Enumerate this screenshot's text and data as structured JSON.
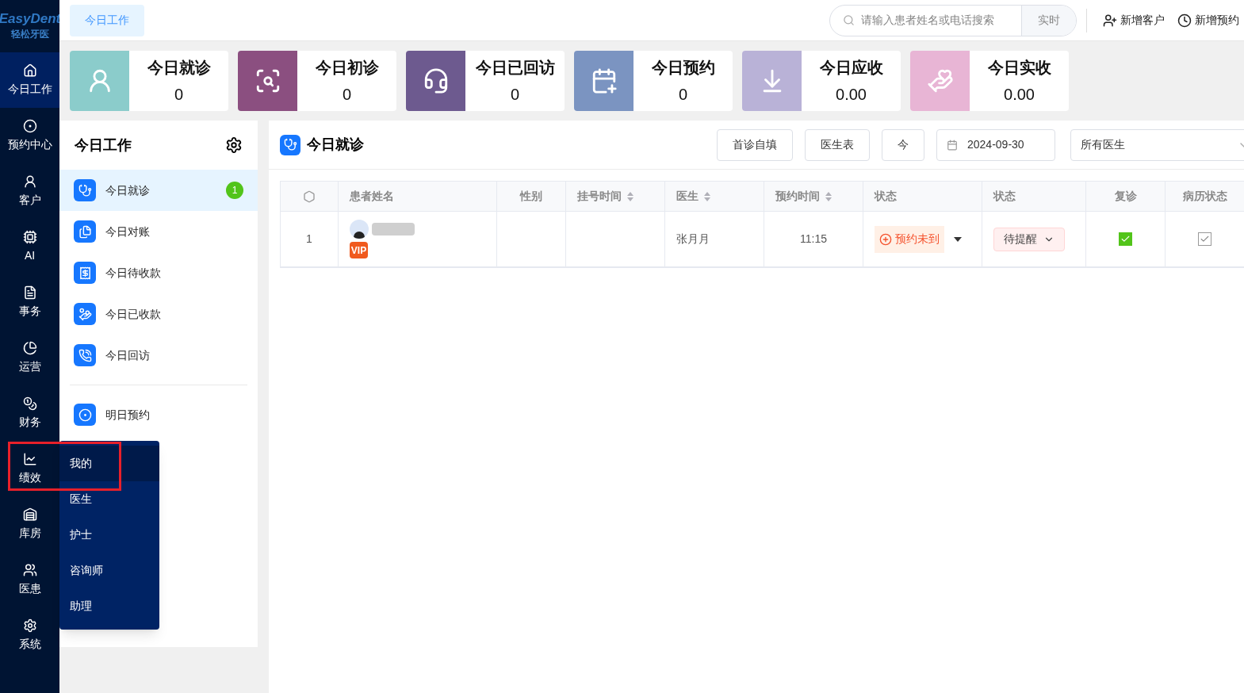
{
  "logo": {
    "title": "EasyDent",
    "subtitle": "轻松牙医"
  },
  "top_tabs": [
    {
      "label": "今日工作",
      "selected": true
    }
  ],
  "search": {
    "placeholder": "请输入患者姓名或电话搜索",
    "mode": "实时"
  },
  "top_actions": [
    {
      "kind": "customer",
      "label": "新增客户"
    },
    {
      "kind": "appointment",
      "label": "新增预约"
    }
  ],
  "nav": [
    {
      "kind": "home",
      "label": "今日工作",
      "selected": true
    },
    {
      "kind": "book",
      "label": "预约中心",
      "selected": false
    },
    {
      "kind": "user",
      "label": "客户",
      "selected": false
    },
    {
      "kind": "ai",
      "label": "AI",
      "selected": false
    },
    {
      "kind": "task",
      "label": "事务",
      "selected": false
    },
    {
      "kind": "pie",
      "label": "运营",
      "selected": false
    },
    {
      "kind": "money",
      "label": "财务",
      "selected": false
    },
    {
      "kind": "chart",
      "label": "绩效",
      "selected": false
    },
    {
      "kind": "store",
      "label": "库房",
      "selected": false
    },
    {
      "kind": "people",
      "label": "医患",
      "selected": false
    },
    {
      "kind": "gear",
      "label": "系统",
      "selected": false
    }
  ],
  "stats": [
    {
      "kind": "doctor",
      "label": "今日就诊",
      "value": "0",
      "color": "#8bcccb"
    },
    {
      "kind": "first",
      "label": "今日初诊",
      "value": "0",
      "color": "#8b4f80"
    },
    {
      "kind": "headset",
      "label": "今日已回访",
      "value": "0",
      "color": "#6d5a8f"
    },
    {
      "kind": "calendar",
      "label": "今日预约",
      "value": "0",
      "color": "#7b94c1"
    },
    {
      "kind": "receivable",
      "label": "今日应收",
      "value": "0.00",
      "color": "#b9b2d7"
    },
    {
      "kind": "received",
      "label": "今日实收",
      "value": "0.00",
      "color": "#e8b5d5"
    }
  ],
  "panel": {
    "title": "今日工作",
    "items": [
      {
        "kind": "stethoscope",
        "label": "今日就诊",
        "selected": true,
        "badge": "1"
      },
      {
        "kind": "doc",
        "label": "今日对账",
        "selected": false
      },
      {
        "kind": "pending",
        "label": "今日待收款",
        "selected": false
      },
      {
        "kind": "paid",
        "label": "今日已收款",
        "selected": false
      },
      {
        "kind": "phone",
        "label": "今日回访",
        "selected": false
      }
    ],
    "items_after_divider": [
      {
        "kind": "book",
        "label": "明日预约",
        "selected": false
      }
    ]
  },
  "popup_menu": {
    "items": [
      {
        "label": "我的",
        "selected": true
      },
      {
        "label": "医生",
        "selected": false
      },
      {
        "label": "护士",
        "selected": false
      },
      {
        "label": "咨询师",
        "selected": false
      },
      {
        "label": "助理",
        "selected": false
      }
    ]
  },
  "main": {
    "title": "今日就诊",
    "buttons": [
      "首诊自填",
      "医生表",
      "今"
    ],
    "date": "2024-09-30",
    "doctor_select": "所有医生",
    "table": {
      "columns": [
        {
          "label": "患者姓名",
          "sortable": false
        },
        {
          "label": "性别",
          "sortable": false
        },
        {
          "label": "挂号时间",
          "sortable": true
        },
        {
          "label": "医生",
          "sortable": true
        },
        {
          "label": "预约时间",
          "sortable": true
        },
        {
          "label": "状态",
          "sortable": false
        },
        {
          "label": "状态",
          "sortable": false
        },
        {
          "label": "复诊",
          "sortable": false
        },
        {
          "label": "病历状态",
          "sortable": false
        }
      ],
      "rows": [
        {
          "index": "1",
          "vip": "VIP",
          "gender": "",
          "register_time": "",
          "doctor": "张月月",
          "appointment_time": "11:15",
          "status": "预约未到",
          "reminder": "待提醒",
          "revisit": {
            "checked": true,
            "kind": "filled"
          },
          "record": {
            "checked": true,
            "kind": "outline"
          }
        }
      ]
    }
  }
}
